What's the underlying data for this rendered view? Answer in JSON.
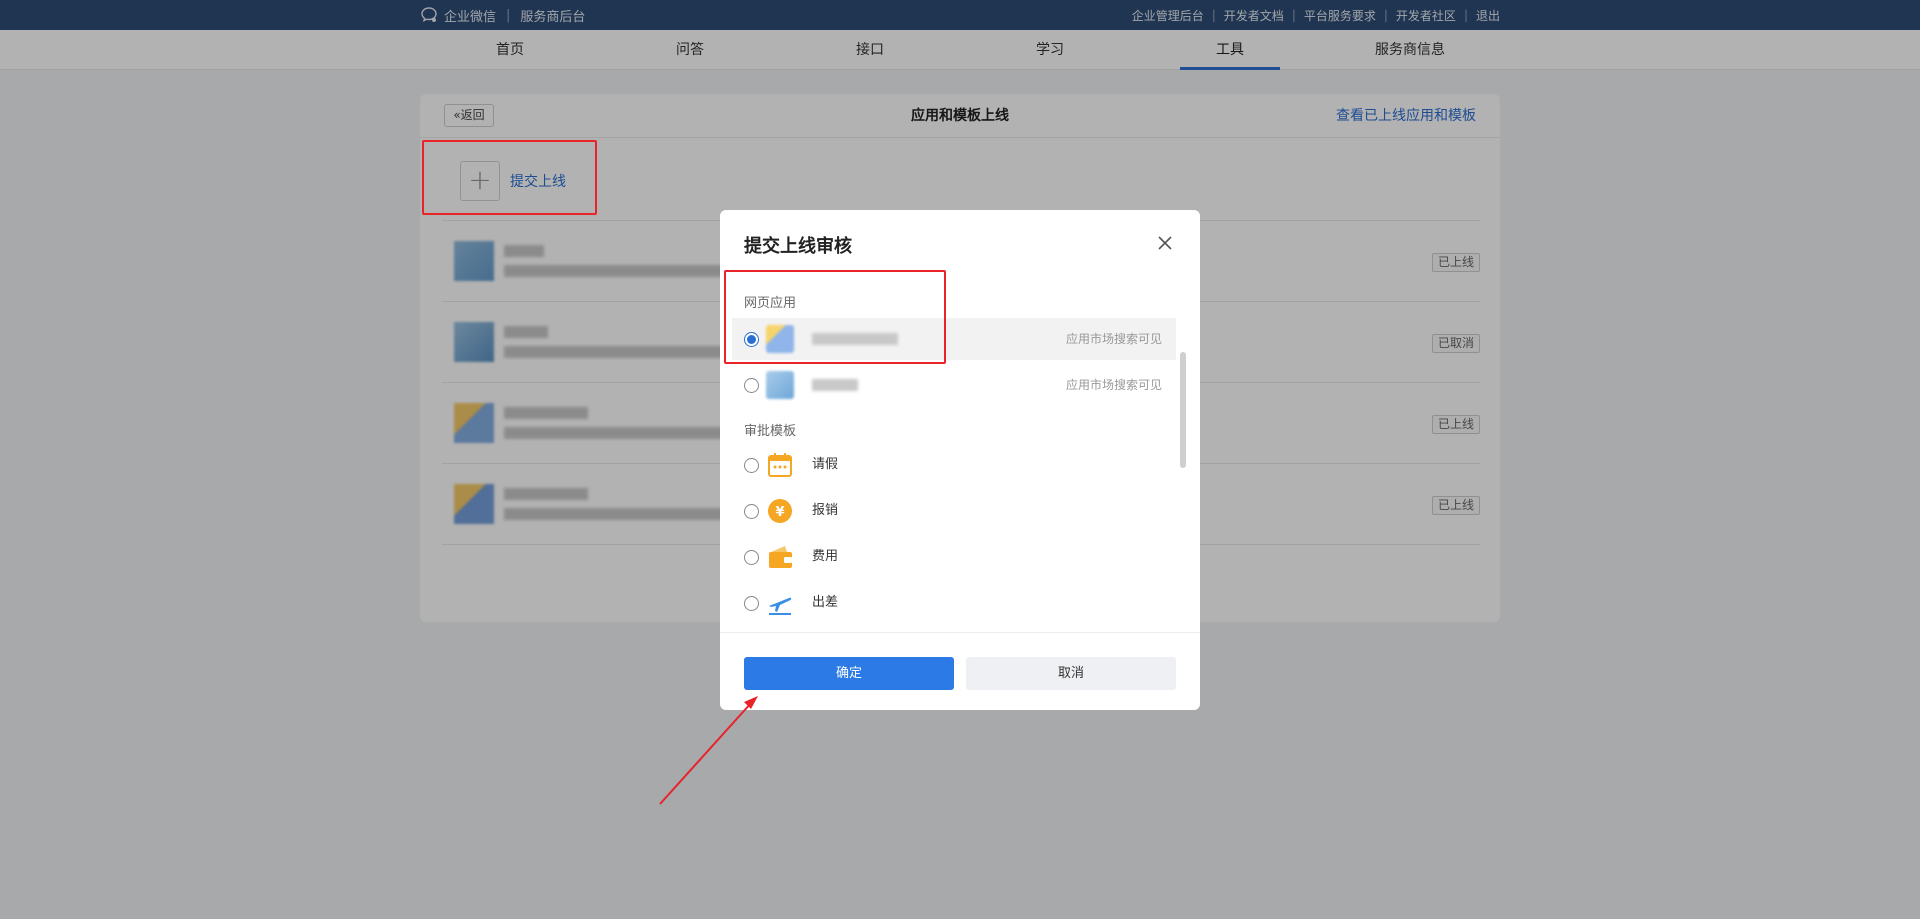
{
  "topbar": {
    "brand": "企业微信",
    "subtitle": "服务商后台",
    "links": [
      "企业管理后台",
      "开发者文档",
      "平台服务要求",
      "开发者社区",
      "退出"
    ]
  },
  "nav": {
    "items": [
      "首页",
      "问答",
      "接口",
      "学习",
      "工具",
      "服务商信息"
    ],
    "active": "工具"
  },
  "panel": {
    "back_label": "返回",
    "title": "应用和模板上线",
    "link": "查看已上线应用和模板",
    "submit_label": "提交上线",
    "statuses": [
      "已上线",
      "已取消",
      "已上线",
      "已上线"
    ]
  },
  "modal": {
    "title": "提交上线审核",
    "section_web": "网页应用",
    "section_approval": "审批模板",
    "web_apps": [
      {
        "hint": "应用市场搜索可见",
        "selected": true
      },
      {
        "hint": "应用市场搜索可见",
        "selected": false
      }
    ],
    "templates": [
      {
        "label": "请假",
        "icon": "calendar-icon"
      },
      {
        "label": "报销",
        "icon": "yuan-coin-icon"
      },
      {
        "label": "费用",
        "icon": "wallet-icon"
      },
      {
        "label": "出差",
        "icon": "airplane-icon"
      }
    ],
    "confirm": "确定",
    "cancel": "取消"
  },
  "colors": {
    "accent": "#2b7ae6",
    "topbar": "#2f4d76",
    "annotation": "#e8232a"
  }
}
